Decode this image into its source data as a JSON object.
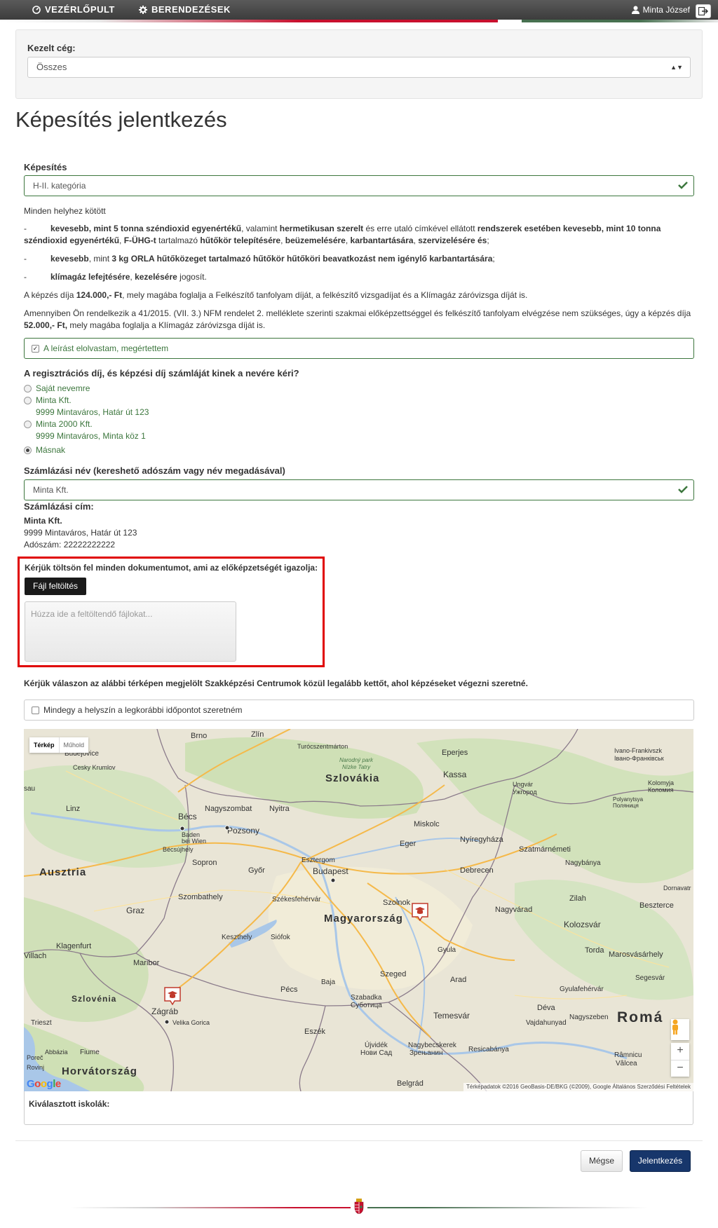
{
  "nav": {
    "dashboard": "VEZÉRLŐPULT",
    "settings": "BERENDEZÉSEK",
    "user": "Minta József"
  },
  "company": {
    "label": "Kezelt cég:",
    "selected": "Összes"
  },
  "page_title": "Képesítés jelentkezés",
  "qualification": {
    "label": "Képesítés",
    "value": "H-II. kategória"
  },
  "description": {
    "intro": "Minden helyhez kötött",
    "item1_a": "kevesebb, mint 5 tonna széndioxid egyenértékű",
    "item1_b": ", valamint ",
    "item1_c": "hermetikusan szerelt",
    "item1_d": " és erre utaló címkével ellátott ",
    "item1_e": "rendszerek esetében kevesebb, mint 10 tonna széndioxid egyenértékű",
    "item1_f": ", ",
    "item1_g": "F-ÜHG-t",
    "item1_h": " tartalmazó ",
    "item1_i": "hűtőkör telepítésére",
    "item1_j": ", ",
    "item1_k": "beüzemelésére",
    "item1_l": ", ",
    "item1_m": "karbantartására",
    "item1_n": ", ",
    "item1_o": "szervizelésére és",
    "item1_p": ";",
    "item2_a": "kevesebb",
    "item2_b": ", mint ",
    "item2_c": "3 kg ORLA hűtőközeget tartalmazó hűtőkör hűtőköri beavatkozást nem igénylő karbantartására",
    "item2_d": ";",
    "item3_a": "klímagáz lefejtésére",
    "item3_b": ", ",
    "item3_c": "kezelésére",
    "item3_d": " jogosít.",
    "fee_a": "A képzés díja ",
    "fee_b": "124.000,- Ft",
    "fee_c": ", mely magába foglalja a Felkészítő tanfolyam díját, a felkészítő vizsgadíjat és a Klímagáz záróvizsga díját is.",
    "exempt_a": "Amennyiben Ön rendelkezik a 41/2015. (VII. 3.) NFM rendelet 2. melléklete szerinti szakmai előképzettséggel és felkészítő tanfolyam elvégzése nem szükséges, úgy a képzés díja ",
    "exempt_b": "52.000,- Ft,",
    "exempt_c": " mely magába foglalja a Klímagáz záróvizsga díját is."
  },
  "ack_checkbox": "A leírást elolvastam, megértettem",
  "invoice_question": "A regisztrációs díj, és képzési díj számláját kinek a nevére kéri?",
  "invoice_options": [
    {
      "name": "Saját nevemre",
      "address": ""
    },
    {
      "name": "Minta Kft.",
      "address": "9999 Mintaváros, Határ út 123"
    },
    {
      "name": "Minta 2000 Kft.",
      "address": "9999 Mintaváros, Minta köz 1"
    },
    {
      "name": "Másnak",
      "address": ""
    }
  ],
  "invoice_selected": 3,
  "billing": {
    "name_label": "Számlázási név (kereshető adószám vagy név megadásával)",
    "name_value": "Minta Kft.",
    "address_label": "Számlázási cím:",
    "address_name": "Minta Kft.",
    "address_line": "9999 Mintaváros, Határ út 123",
    "tax_id": "Adószám: 22222222222"
  },
  "upload": {
    "label": "Kérjük töltsön fel minden dokumentumot, ami az előképzetségét igazolja:",
    "button": "Fájl feltöltés",
    "placeholder": "Húzza ide a feltöltendő fájlokat..."
  },
  "map_section": {
    "instruction": "Kérjük válaszon az alábbi térképen megjelölt Szakképzési Centrumok közül legalább kettőt, ahol képzéseket végezni szeretné.",
    "any_location": "Mindegy a helyszín a legkorábbi időpontot szeretném",
    "tab_map": "Térkép",
    "tab_satellite": "Műhold",
    "attribution": "Térképadatok ©2016 GeoBasis-DE/BKG (©2009), Google    Általános Szerződési Feltételek",
    "google": "Google",
    "selected_schools": "Kiválasztott iskolák:",
    "labels": {
      "brno": "Brno",
      "zlin": "Zlín",
      "turcianske": "Turócszentmárton",
      "eperjes": "Eperjes",
      "ivano": "Ivano-Frankivszk",
      "ivano2": "Івано-Франківськ",
      "budejovice": "Budějovice",
      "ceskykrumlov": "Cesky Krumlov",
      "narodny": "Narodný park",
      "narodny2": "Nízke Tatry",
      "szlovakia": "Szlovákia",
      "kassa": "Kassa",
      "ungvar": "Ungvár",
      "ungvar2": "Ужгород",
      "kolomija": "Kolomyja",
      "kolomija2": "Коломия",
      "polyanytsya": "Polyanytsya",
      "polyanytsya2": "Поляниця",
      "linz": "Linz",
      "becs": "Bécs",
      "nagyszombat": "Nagyszombat",
      "nyitra": "Nyitra",
      "pozsony": "Pozsony",
      "miskolc": "Miskolc",
      "baden": "Baden",
      "baden2": "bei Wien",
      "becsujhely": "Bécsújhely",
      "eger": "Eger",
      "nyiregyhaza": "Nyíregyháza",
      "szatmar": "Szatmárnémeti",
      "ausztria": "Ausztria",
      "esztergom": "Esztergom",
      "gyor": "Győr",
      "sopron": "Sopron",
      "budapest": "Budapest",
      "debrecen": "Debrecen",
      "nagybanya": "Nagybánya",
      "dornavatra": "Dornavatr",
      "szombathely": "Szombathely",
      "szekesfehervar": "Székesfehérvár",
      "szolnok": "Szolnok",
      "zilah": "Zilah",
      "beszterce": "Beszterce",
      "graz": "Graz",
      "magyarorszag": "Magyarország",
      "nagyvarad": "Nagyvárad",
      "kolozsvar": "Kolozsvár",
      "keszthely": "Keszthely",
      "siofok": "Siófok",
      "gyula": "Gyula",
      "torda": "Torda",
      "marosvasarhely": "Marosvásárhely",
      "villach": "Villach",
      "klagenfurt": "Klagenfurt",
      "maribor": "Maribor",
      "szeged": "Szeged",
      "arad": "Arad",
      "segesvar": "Segesvár",
      "gyulafehervar": "Gyulafehérvár",
      "baja": "Baja",
      "szlovenia": "Szlovénia",
      "pecs": "Pécs",
      "szabadka": "Szabadka",
      "szabadka2": "Суботица",
      "deva": "Déva",
      "zagrab": "Zágráb",
      "temesvar": "Temesvár",
      "nagyszeben": "Nagyszeben",
      "romania": "Romá",
      "velika": "Velika Gorica",
      "eszek": "Eszék",
      "vajdahunyad": "Vajdahunyad",
      "trieszt": "Trieszt",
      "ujvidek": "Újvidék",
      "ujvidek2": "Нови Сад",
      "nagybecskerek": "Nagybecskerek",
      "nagybecskerek2": "Зрењанин",
      "resicabanya": "Resicabánya",
      "rimnicu": "Râmnicu",
      "rimnicu2": "Vâlcea",
      "abbazia": "Abbázia",
      "fiume": "Fiume",
      "porec": "Poreč",
      "rovinj": "Rovinj",
      "horvatorszag": "Horvátország",
      "belgrad": "Belgrád",
      "sau": "sau"
    }
  },
  "buttons": {
    "cancel": "Mégse",
    "submit": "Jelentkezés"
  },
  "colors": {
    "navbar": "#4a4a4a",
    "success": "#3c763d",
    "primary": "#17366b",
    "highlight": "#e00000"
  }
}
